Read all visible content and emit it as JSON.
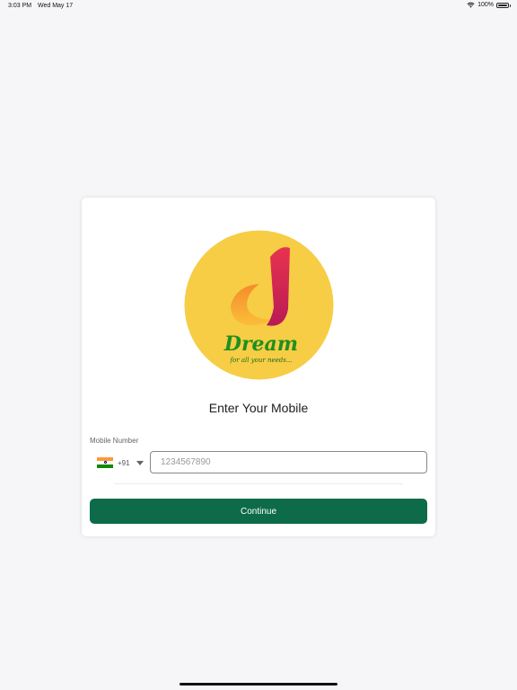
{
  "status_bar": {
    "time": "3:03 PM",
    "date": "Wed May 17",
    "battery": "100%",
    "icons": [
      "wifi-icon",
      "battery-icon"
    ]
  },
  "logo": {
    "brand_text": "Dream",
    "tagline": "for all your needs...",
    "colors": {
      "circle": "#f6cd45",
      "letter_top": "#d81b4e",
      "letter_bottom": "#f79b2e",
      "text": "#1f8f1f"
    }
  },
  "login": {
    "title": "Enter Your Mobile",
    "field_label": "Mobile Number",
    "country": {
      "flag": "india-flag-icon",
      "dial_code": "+91"
    },
    "phone_placeholder": "1234567890",
    "phone_value": "",
    "continue_label": "Continue"
  },
  "colors": {
    "primary": "#0e6b4a",
    "background": "#f6f6f8",
    "card": "#ffffff"
  }
}
